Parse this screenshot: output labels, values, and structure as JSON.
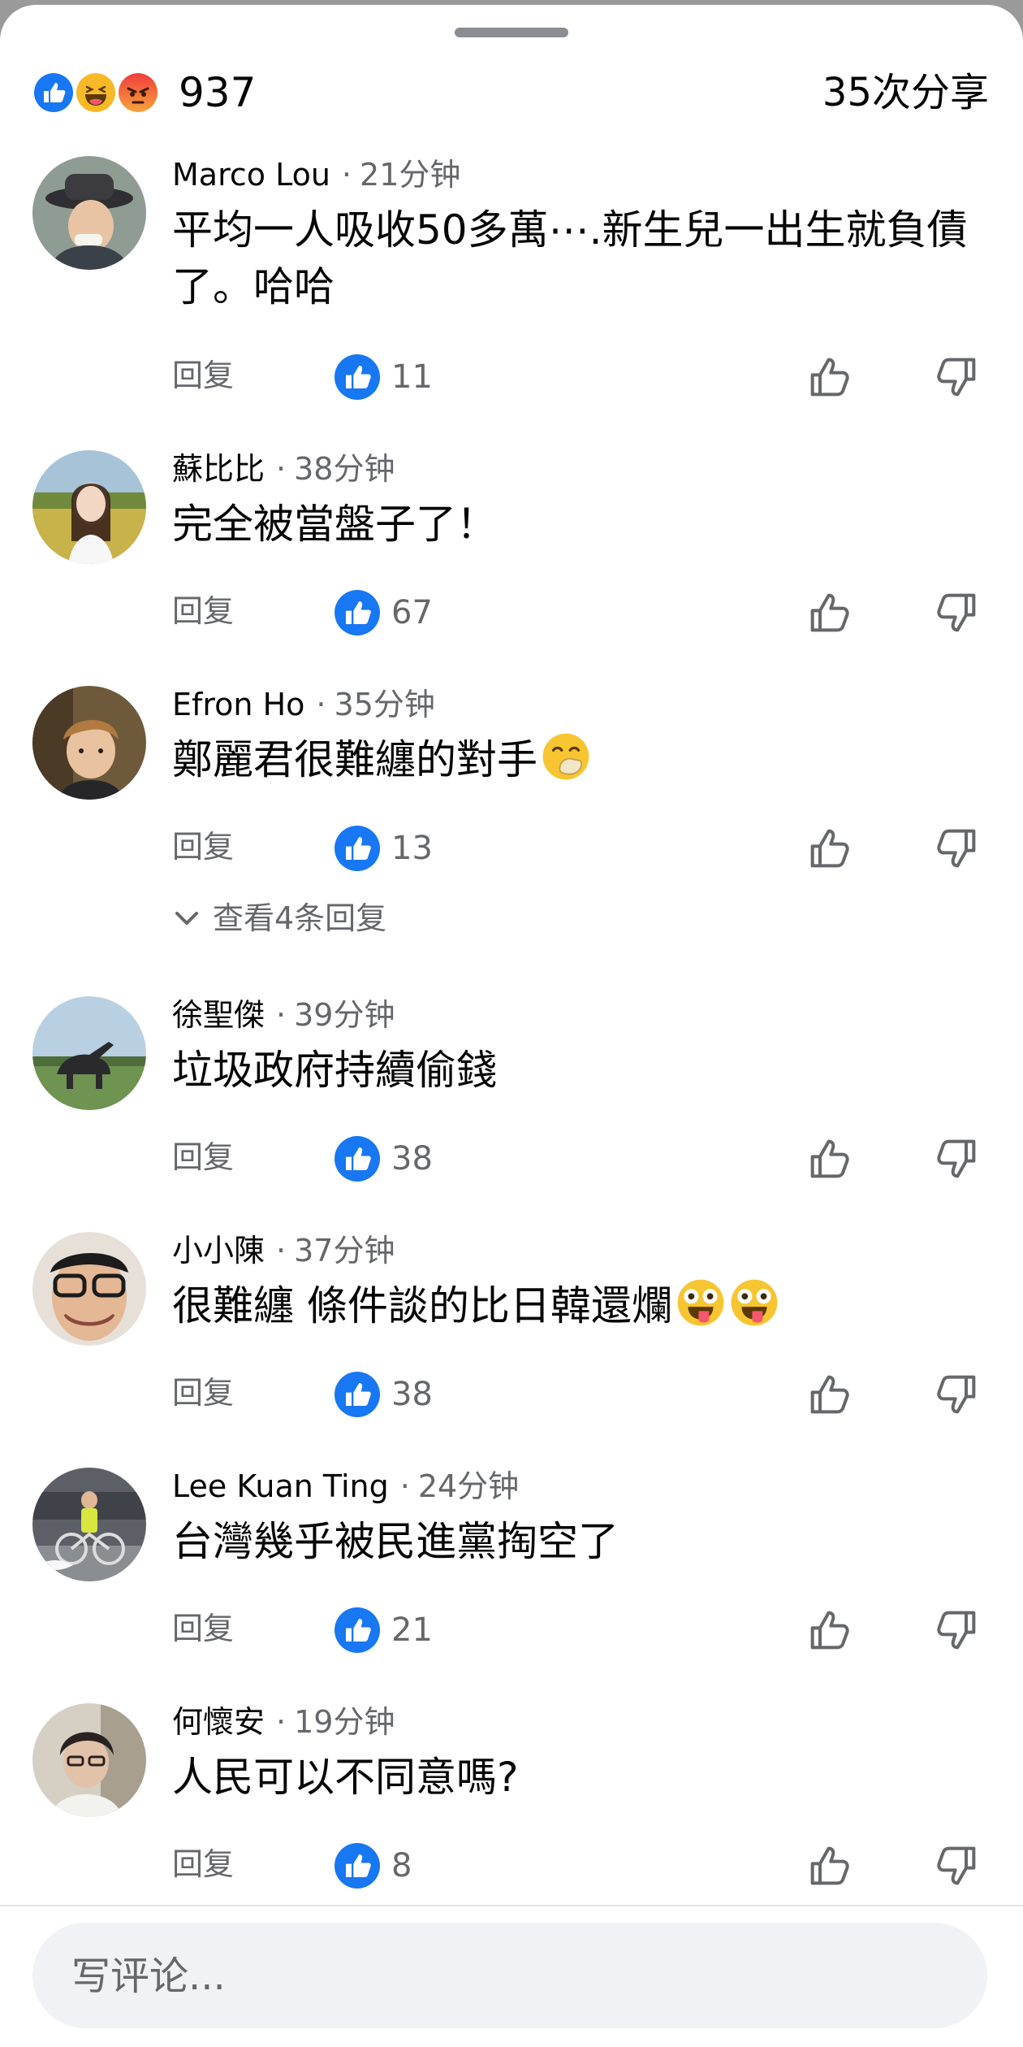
{
  "summary": {
    "reactions": [
      "like-icon",
      "haha-icon",
      "angry-icon"
    ],
    "reaction_count": "937",
    "shares": "35次分享"
  },
  "colors": {
    "like_blue": "#1877f2",
    "secondary_text": "#65676b",
    "composer_bg": "#f0f2f5"
  },
  "comments": [
    {
      "author": "Marco Lou",
      "time": "21分钟",
      "text": "平均一人吸收50多萬⋯.新生兒一出生就負債了。哈哈",
      "reply_label": "回复",
      "likes": "11"
    },
    {
      "author": "蘇比比",
      "time": "38分钟",
      "text": "完全被當盤子了！",
      "reply_label": "回复",
      "likes": "67"
    },
    {
      "author": "Efron Ho",
      "time": "35分钟",
      "text": "鄭麗君很難纏的對手",
      "emoji": "face-with-hand-over-mouth",
      "reply_label": "回复",
      "likes": "13",
      "view_replies": "查看4条回复"
    },
    {
      "author": "徐聖傑",
      "time": "39分钟",
      "text": "垃圾政府持續偷錢",
      "reply_label": "回复",
      "likes": "38"
    },
    {
      "author": "小小陳",
      "time": "37分钟",
      "text": "很難纏 條件談的比日韓還爛",
      "emoji": "zany-face x2",
      "reply_label": "回复",
      "likes": "38"
    },
    {
      "author": "Lee Kuan Ting",
      "time": "24分钟",
      "text": "台灣幾乎被民進黨掏空了",
      "reply_label": "回复",
      "likes": "21"
    },
    {
      "author": "何懷安",
      "time": "19分钟",
      "text": "人民可以不同意嗎?",
      "reply_label": "回复",
      "likes": "8"
    }
  ],
  "composer": {
    "placeholder": "写评论..."
  }
}
